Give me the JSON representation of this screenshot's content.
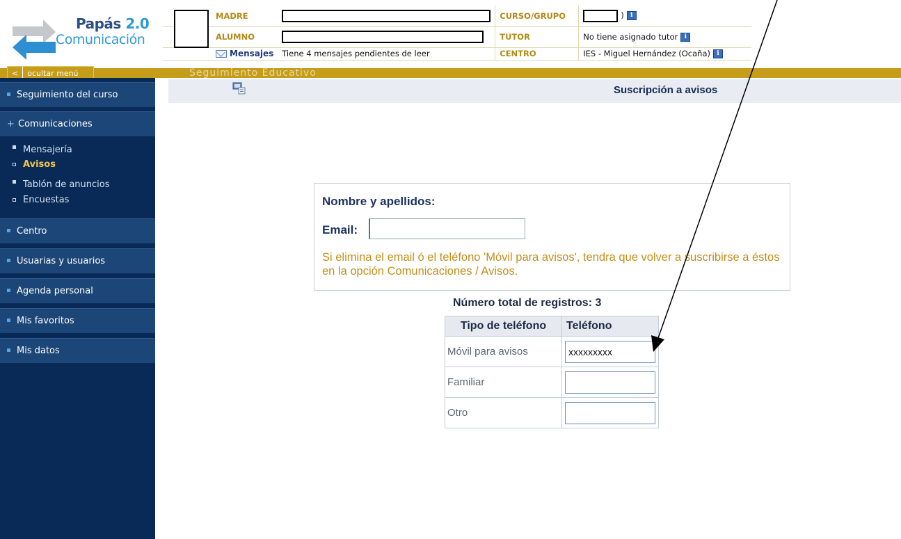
{
  "header": {
    "logo": {
      "line1": "Papás",
      "line1_version": "2.0",
      "line2": "Comunicación"
    },
    "rows": [
      {
        "label": "MADRE",
        "right_label": "CURSO/GRUPO"
      },
      {
        "label": "ALUMNO",
        "right_label": "TUTOR",
        "right_value": "No tiene asignado tutor"
      },
      {
        "label": "Mensajes",
        "value": "Tiene 4 mensajes pendientes de leer",
        "right_label": "CENTRO",
        "right_value": "IES - Miguel Hernández (Ocaña)"
      }
    ],
    "info_icon": "i"
  },
  "menu_toggle": {
    "chevron": "<",
    "label": "ocultar menú"
  },
  "section_banner": "Seguimiento Educativo",
  "sidebar": {
    "items": [
      {
        "label": "Seguimiento del curso"
      },
      {
        "label": "Comunicaciones",
        "expanded": true
      },
      {
        "label": "Centro"
      },
      {
        "label": "Usuarias y usuarios"
      },
      {
        "label": "Agenda personal"
      },
      {
        "label": "Mis favoritos"
      },
      {
        "label": "Mis datos"
      }
    ],
    "sub_items": [
      {
        "label": "Mensajería"
      },
      {
        "label": "Avisos",
        "active": true
      },
      {
        "label": "Tablón de anuncios"
      },
      {
        "label": "Encuestas"
      }
    ]
  },
  "main": {
    "title": "Suscripción a avisos",
    "form": {
      "name_label": "Nombre y apellidos:",
      "email_label": "Email:",
      "email_value": "",
      "warning": "Si elimina el email ó el teléfono 'Móvil para avisos', tendra que volver a suscribirse a éstos en la opción Comunicaciones / Avisos."
    },
    "records_label": "Número total de registros:",
    "records_count": "3",
    "phones_table": {
      "headers": [
        "Tipo de teléfono",
        "Teléfono"
      ],
      "rows": [
        {
          "type": "Móvil para avisos",
          "phone": "xxxxxxxxx"
        },
        {
          "type": "Familiar",
          "phone": ""
        },
        {
          "type": "Otro",
          "phone": ""
        }
      ]
    }
  },
  "colors": {
    "gold": "#c69d1a",
    "sidebar_bg": "#092a56",
    "sidebar_item": "#1c4677",
    "title_text": "#142a55",
    "warning_text": "#c3901c"
  }
}
